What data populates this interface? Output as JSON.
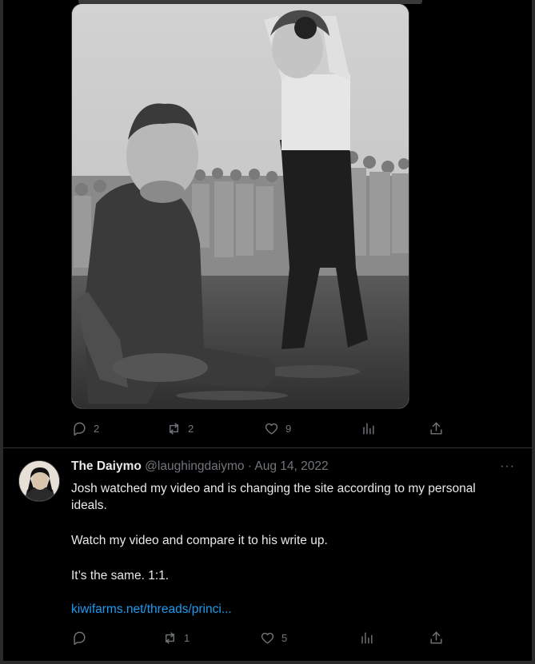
{
  "previous_tweet": {
    "metrics": {
      "replies": "2",
      "retweets": "2",
      "likes": "9"
    }
  },
  "tweet": {
    "display_name": "The Daiymo",
    "handle": "@laughingdaiymo",
    "separator": "·",
    "date": "Aug 14, 2022",
    "more_label": "···",
    "text_line_1": "Josh watched my video and is changing the site according to my personal",
    "text_line_2": "ideals.",
    "text_line_3": "Watch my video and compare it to his write up.",
    "text_line_4": "It’s the same. 1:1.",
    "link_text": "kiwifarms.net/threads/princi...",
    "metrics": {
      "replies": "",
      "retweets": "1",
      "likes": "5"
    }
  },
  "colors": {
    "background": "#000000",
    "text": "#e7e9ea",
    "muted": "#71767b",
    "link": "#1d9bf0",
    "border": "#2f3336"
  },
  "icons": [
    "reply-icon",
    "retweet-icon",
    "like-icon",
    "views-icon",
    "share-icon",
    "more-icon"
  ]
}
